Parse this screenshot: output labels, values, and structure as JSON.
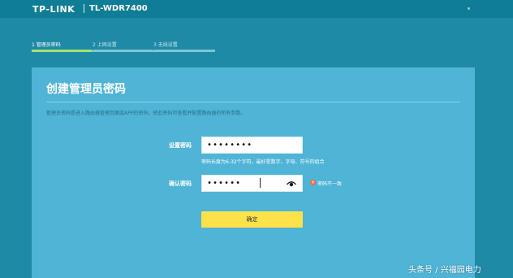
{
  "header": {
    "brand": "TP-LINK",
    "model": "TL-WDR7400"
  },
  "steps": [
    {
      "label": "1 管理员密码",
      "active": true
    },
    {
      "label": "2 上网设置",
      "active": false
    },
    {
      "label": "3 无线设置",
      "active": false
    }
  ],
  "panel": {
    "title": "创建管理员密码",
    "description": "管理员密码是进入路由器管理页面或APP的密码，使此密码可查看并配置路由器的所有参数。"
  },
  "form": {
    "password_label": "设置密码",
    "password_value": "••••••••",
    "hint": "密码长度为6-32个字符，最好是数字、字母、符号的组合",
    "confirm_label": "确认密码",
    "confirm_value": "••••••",
    "error": "密码不一致",
    "submit_label": "确定"
  },
  "watermark": "头条号 / 兴福园电力",
  "colors": {
    "background": "#1f8aa6",
    "panel": "#4fb4d6",
    "progress": "#a6e06f",
    "button": "#ffe14a",
    "error": "#f06a3e"
  },
  "icons": [
    "eye-icon",
    "error-icon"
  ]
}
